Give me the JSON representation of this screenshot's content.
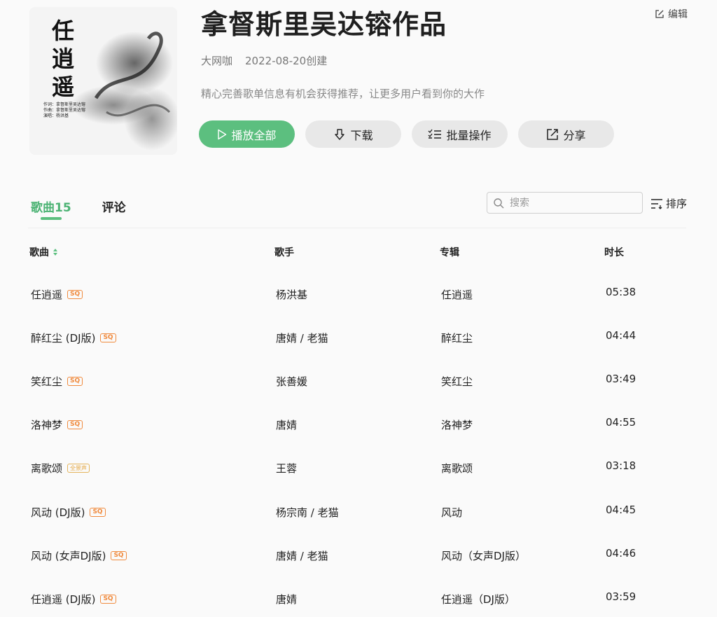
{
  "playlist": {
    "title": "拿督斯里吴达镕作品",
    "creator": "大网咖",
    "created": "2022-08-20创建",
    "description": "精心完善歌单信息有机会获得推荐，让更多用户看到你的大作",
    "edit_label": "编辑",
    "cover": {
      "title_chars": [
        "任",
        "逍",
        "遥"
      ],
      "credits": [
        "作词：拿督斯里吴达镕",
        "作曲：拿督斯里吴达镕",
        "演唱：杨洪基"
      ]
    }
  },
  "actions": {
    "play_all": "播放全部",
    "download": "下载",
    "batch": "批量操作",
    "share": "分享"
  },
  "tabs": {
    "songs": "歌曲15",
    "comments": "评论"
  },
  "search": {
    "placeholder": "搜索"
  },
  "sort_label": "排序",
  "columns": {
    "song": "歌曲",
    "artist": "歌手",
    "album": "专辑",
    "duration": "时长"
  },
  "songs": [
    {
      "title": "任逍遥",
      "badge": "SQ",
      "artist": "杨洪基",
      "album": "任逍遥",
      "duration": "05:38"
    },
    {
      "title": "醉红尘 (DJ版)",
      "badge": "SQ",
      "artist": "唐婧 / 老猫",
      "album": "醉红尘",
      "duration": "04:44"
    },
    {
      "title": "笑红尘",
      "badge": "SQ",
      "artist": "张善媛",
      "album": "笑红尘",
      "duration": "03:49"
    },
    {
      "title": "洛神梦",
      "badge": "SQ",
      "artist": "唐婧",
      "album": "洛神梦",
      "duration": "04:55"
    },
    {
      "title": "离歌颂",
      "badge": "全景声",
      "artist": "王蓉",
      "album": "离歌颂",
      "duration": "03:18"
    },
    {
      "title": "风动 (DJ版)",
      "badge": "SQ",
      "artist": "杨宗南 / 老猫",
      "album": "风动",
      "duration": "04:45"
    },
    {
      "title": "风动 (女声DJ版)",
      "badge": "SQ",
      "artist": "唐婧 / 老猫",
      "album": "风动（女声DJ版）",
      "duration": "04:46"
    },
    {
      "title": "任逍遥 (DJ版)",
      "badge": "SQ",
      "artist": "唐婧",
      "album": "任逍遥（DJ版）",
      "duration": "03:59"
    }
  ],
  "colors": {
    "accent": "#5cbf7f",
    "badge": "#f08a3d",
    "badge_gold": "#e4a640"
  },
  "icons": [
    "edit-icon",
    "play-icon",
    "download-icon",
    "batch-icon",
    "share-icon",
    "search-icon",
    "sort-icon",
    "sort-arrows-icon"
  ]
}
